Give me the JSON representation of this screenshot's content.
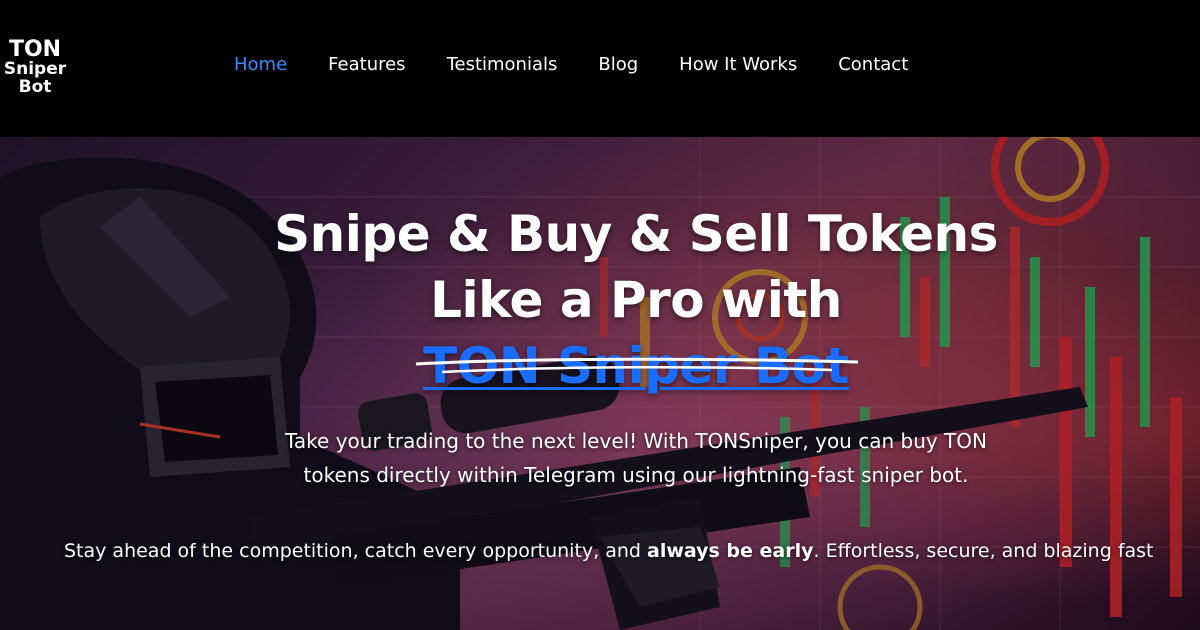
{
  "logo": {
    "line1": "TON",
    "line2": "Sniper",
    "line3": "Bot"
  },
  "nav": {
    "items": [
      {
        "label": "Home",
        "active": true
      },
      {
        "label": "Features",
        "active": false
      },
      {
        "label": "Testimonials",
        "active": false
      },
      {
        "label": "Blog",
        "active": false
      },
      {
        "label": "How It Works",
        "active": false
      },
      {
        "label": "Contact",
        "active": false
      }
    ]
  },
  "hero": {
    "headline_line1": "Snipe & Buy & Sell Tokens",
    "headline_line2": "Like a Pro with",
    "headline_brand": "TON Sniper Bot",
    "description_line1": "Take your trading to the next level! With TONSniper, you can buy TON",
    "description_line2": "tokens directly within Telegram using our lightning-fast sniper bot.",
    "sub_part1": "Stay ahead of the competition, catch every opportunity, and ",
    "sub_bold": "always be early",
    "sub_part2": ". Effortless, secure, and blazing fast"
  },
  "colors": {
    "header_bg": "#000000",
    "nav_active": "#3d8bff",
    "brand_blue": "#1a6cff",
    "text": "#ffffff"
  }
}
